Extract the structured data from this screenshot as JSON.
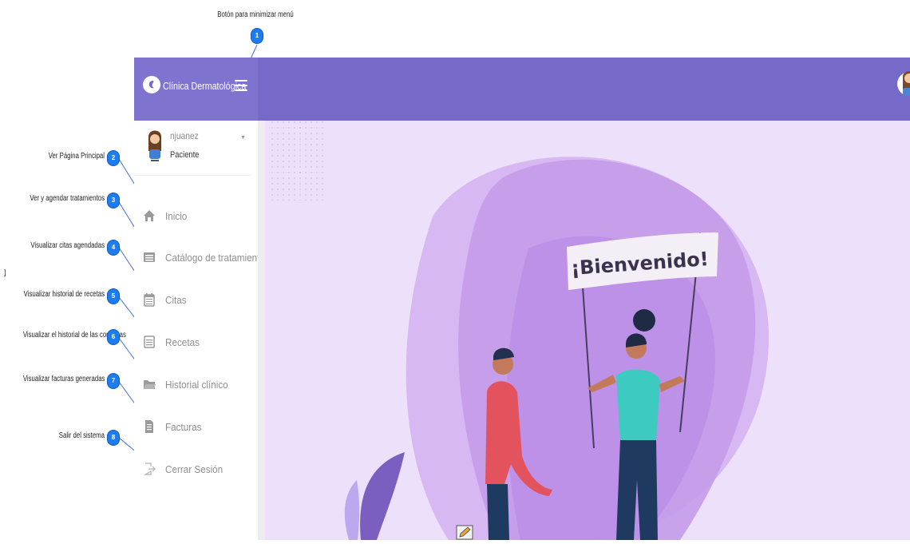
{
  "annotations": {
    "minimize_menu": "Botón para minimizar menú",
    "items": [
      {
        "number": "2",
        "text": "Ver Página Principal"
      },
      {
        "number": "3",
        "text": "Ver y agendar tratamientos"
      },
      {
        "number": "4",
        "text": "Visualizar citas agendadas"
      },
      {
        "number": "5",
        "text": "Visualizar historial de recetas"
      },
      {
        "number": "6",
        "text": "Visualizar el historial de las consultas"
      },
      {
        "number": "7",
        "text": "Visualizar facturas generadas"
      },
      {
        "number": "8",
        "text": "Salir del sistema"
      }
    ],
    "minimize_number": "1",
    "stray_mark": "]"
  },
  "header": {
    "brand": "Clínica Dermatológica",
    "color": "#7569c9"
  },
  "user": {
    "name": "njuanez",
    "role": "Paciente"
  },
  "sidebar": {
    "items": [
      {
        "label": "Inicio",
        "icon": "home-icon"
      },
      {
        "label": "Catálogo de tratamientos",
        "icon": "list-icon"
      },
      {
        "label": "Citas",
        "icon": "calendar-icon"
      },
      {
        "label": "Recetas",
        "icon": "document-icon"
      },
      {
        "label": "Historial clínico",
        "icon": "folder-icon"
      },
      {
        "label": "Facturas",
        "icon": "invoice-icon"
      },
      {
        "label": "Cerrar Sesión",
        "icon": "logout-icon"
      }
    ]
  },
  "main": {
    "banner_text": "¡Bienvenido!",
    "background": "#ece0fb"
  }
}
